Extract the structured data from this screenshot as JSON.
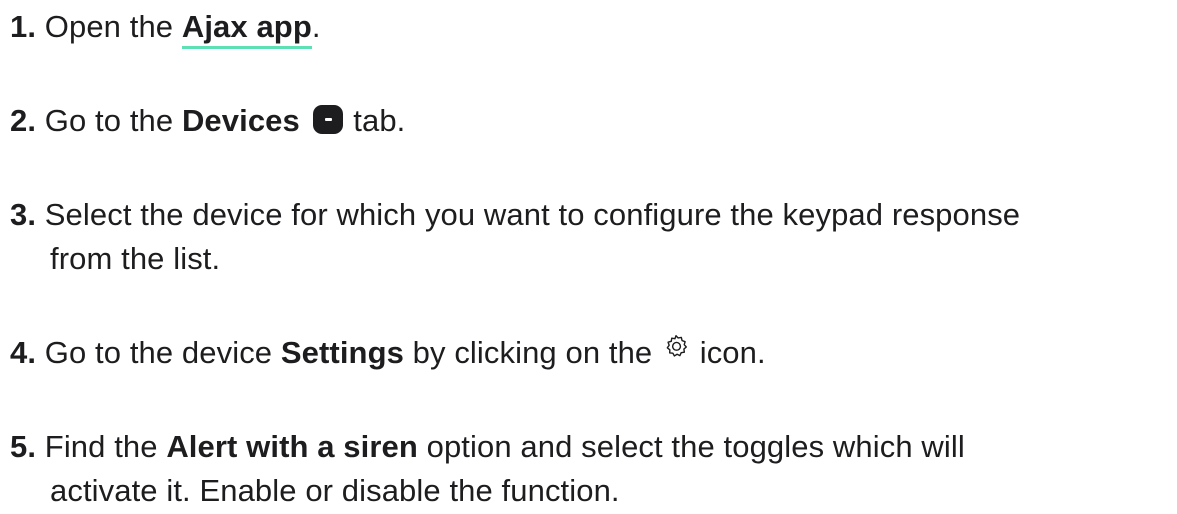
{
  "steps": [
    {
      "num": "1.",
      "before": "Open the",
      "link": "Ajax app",
      "after": "."
    },
    {
      "num": "2.",
      "before": "Go to the",
      "bold": "Devices",
      "icon": "devices-tab-icon",
      "after": "tab."
    },
    {
      "num": "3.",
      "line1": "Select the device for which you want to configure the keypad response",
      "line2": "from the list."
    },
    {
      "num": "4.",
      "before": "Go to the device",
      "bold": "Settings",
      "middle": "by clicking on the",
      "icon": "gear-icon",
      "after": "icon."
    },
    {
      "num": "5.",
      "before": "Find the",
      "bold": "Alert with a siren",
      "after": "option and select the toggles which will",
      "line2": "activate it. Enable or disable the function."
    }
  ],
  "colors": {
    "text": "#1d1d1f",
    "link_underline": "#5ce0b4"
  }
}
